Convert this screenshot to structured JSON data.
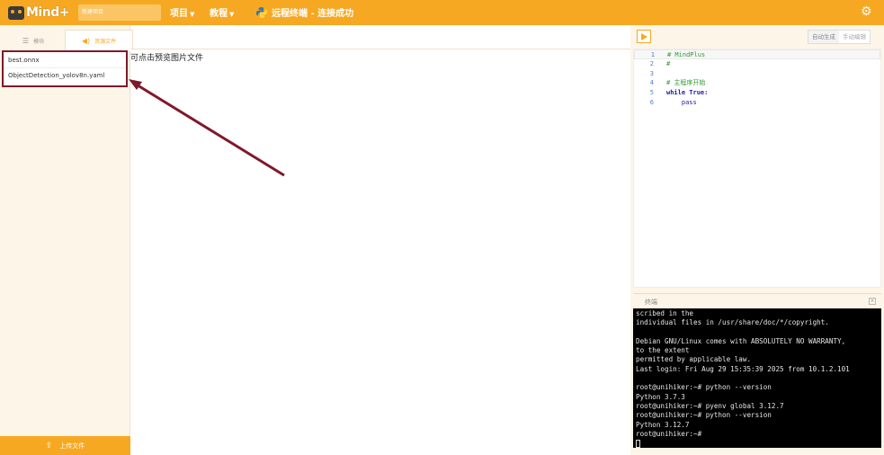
{
  "header": {
    "logo_text": "Mind+",
    "project_name": "新建项目",
    "menu_project": "项目",
    "menu_tutorial": "教程",
    "connection_status": "远程终端 - 连接成功"
  },
  "left": {
    "tab_modules": "模块",
    "tab_resources": "资源文件",
    "files": [
      "best.onnx",
      "ObjectDetection_yolov8n.yaml"
    ],
    "upload_label": "上传文件"
  },
  "preview": {
    "hint": "可点击预览图片文件"
  },
  "right": {
    "mode_auto": "自动生成",
    "mode_manual": "手动编辑",
    "code": [
      {
        "num": "1",
        "text": "# MindPlus"
      },
      {
        "num": "2",
        "text": "#"
      },
      {
        "num": "3",
        "text": ""
      },
      {
        "num": "4",
        "text": "# 主程序开始"
      },
      {
        "num": "5",
        "text": "while True:"
      },
      {
        "num": "6",
        "text": "    pass"
      }
    ],
    "terminal_title": "终端",
    "terminal_lines": [
      "scribed in the",
      "individual files in /usr/share/doc/*/copyright.",
      "",
      "Debian GNU/Linux comes with ABSOLUTELY NO WARRANTY,",
      "to the extent",
      "permitted by applicable law.",
      "Last login: Fri Aug 29 15:35:39 2025 from 10.1.2.101",
      "",
      "root@unihiker:~# python --version",
      "Python 3.7.3",
      "root@unihiker:~# pyenv global 3.12.7",
      "root@unihiker:~# python --version",
      "Python 3.12.7",
      "root@unihiker:~#"
    ]
  },
  "colors": {
    "brand_orange": "#f7a823",
    "annotation_red": "#7d1a2a"
  }
}
